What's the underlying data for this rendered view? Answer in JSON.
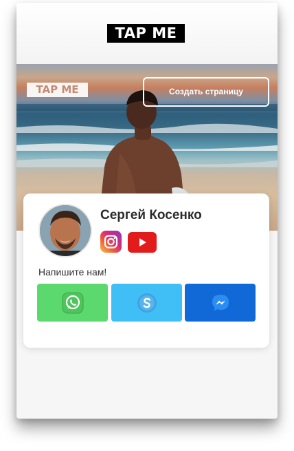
{
  "header": {
    "logo_text": "TAP ME"
  },
  "hero": {
    "logo_text": "TAP ME",
    "create_button_label": "Создать страницу"
  },
  "profile": {
    "name": "Сергей Косенко",
    "socials": [
      {
        "icon": "instagram-icon"
      },
      {
        "icon": "youtube-icon"
      }
    ]
  },
  "contact": {
    "label": "Напишите нам!",
    "buttons": [
      {
        "icon": "whatsapp-icon",
        "color": "#5cd96e"
      },
      {
        "icon": "skype-icon",
        "color": "#3fbff5"
      },
      {
        "icon": "messenger-icon",
        "color": "#1069d6"
      }
    ]
  },
  "colors": {
    "logo_bg": "#000000",
    "hero_logo_text": "#c68a73",
    "youtube": "#e21b1b"
  }
}
